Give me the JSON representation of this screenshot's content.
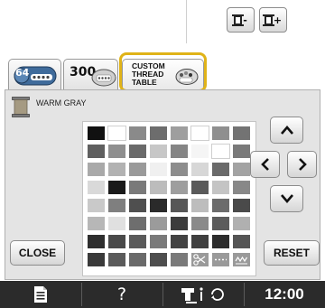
{
  "toolbar": {
    "thread_minus_label": "-",
    "thread_plus_label": "+"
  },
  "tabs": {
    "tab_64_label": "64",
    "tab_300_label": "300",
    "tab_custom_line1": "CUSTOM",
    "tab_custom_line2": "THREAD",
    "tab_custom_line3": "TABLE"
  },
  "selected_color": {
    "name": "WARM GRAY",
    "swatch_color": "#a59a82"
  },
  "palette": {
    "rows": [
      [
        "#111111",
        "#ffffff",
        "#8a8a8a",
        "#6d6d6d",
        "#9e9e9e",
        "#ffffff",
        "#8f8f8f",
        "#737373"
      ],
      [
        "#5f5f5f",
        "#8f8f8f",
        "#6a6a6a",
        "#c7c7c7",
        "#858585",
        "#f5f5f5",
        "#ffffff",
        "#7a7a7a"
      ],
      [
        "#a9a9a9",
        "#b2b2b2",
        "#9a9a9a",
        "#f0f0f0",
        "#8d8d8d",
        "#d7d7d7",
        "#6a6a6a",
        "#a3a3a3"
      ],
      [
        "#d9d9d9",
        "#1a1a1a",
        "#7a7a7a",
        "#bcbcbc",
        "#9e9e9e",
        "#5a5a5a",
        "#c4c4c4",
        "#888888"
      ],
      [
        "#c9c9c9",
        "#7f7f7f",
        "#4f4f4f",
        "#2a2a2a",
        "#575757",
        "#bdbdbd",
        "#6c6c6c",
        "#4a4a4a"
      ],
      [
        "#b7b7b7",
        "#e0e0e0",
        "#6e6e6e",
        "#9b9b9b",
        "#3c3c3c",
        "#8a8a8a",
        "#5c5c5c",
        "#b0b0b0"
      ],
      [
        "#2e2e2e",
        "#4a4a4a",
        "#5a5a5a",
        "#7a7a7a",
        "#434343",
        "#3f3f3f",
        "#2c2c2c",
        "#555555"
      ],
      [
        "#3a3a3a",
        "#5b5b5b",
        "#6a6a6a",
        "#4e4e4e",
        "#7a7a7a",
        "special-scissors",
        "special-dash",
        "special-wave"
      ]
    ]
  },
  "nav": {
    "up_label": "▲",
    "down_label": "▼",
    "left_label": "◀",
    "right_label": "▶"
  },
  "buttons": {
    "close_label": "CLOSE",
    "reset_label": "RESET"
  },
  "status_bar": {
    "help_label": "?",
    "time": "12:00"
  },
  "colors": {
    "highlight": "#e0b318",
    "status_bar_bg": "#2b2b2b"
  }
}
